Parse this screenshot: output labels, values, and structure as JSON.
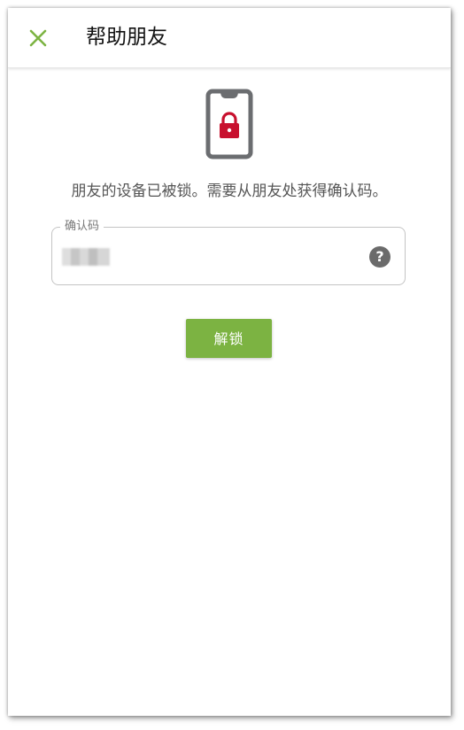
{
  "header": {
    "title": "帮助朋友",
    "close_icon": "close-icon",
    "accent_color": "#7cb342"
  },
  "main": {
    "illustration_icon": "locked-phone-icon",
    "lock_color": "#c8102e",
    "message": "朋友的设备已被锁。需要从朋友处获得确认码。",
    "code_field": {
      "label": "确认码",
      "value": "",
      "help_icon": "help-icon"
    },
    "unlock_button": {
      "label": "解锁"
    }
  }
}
